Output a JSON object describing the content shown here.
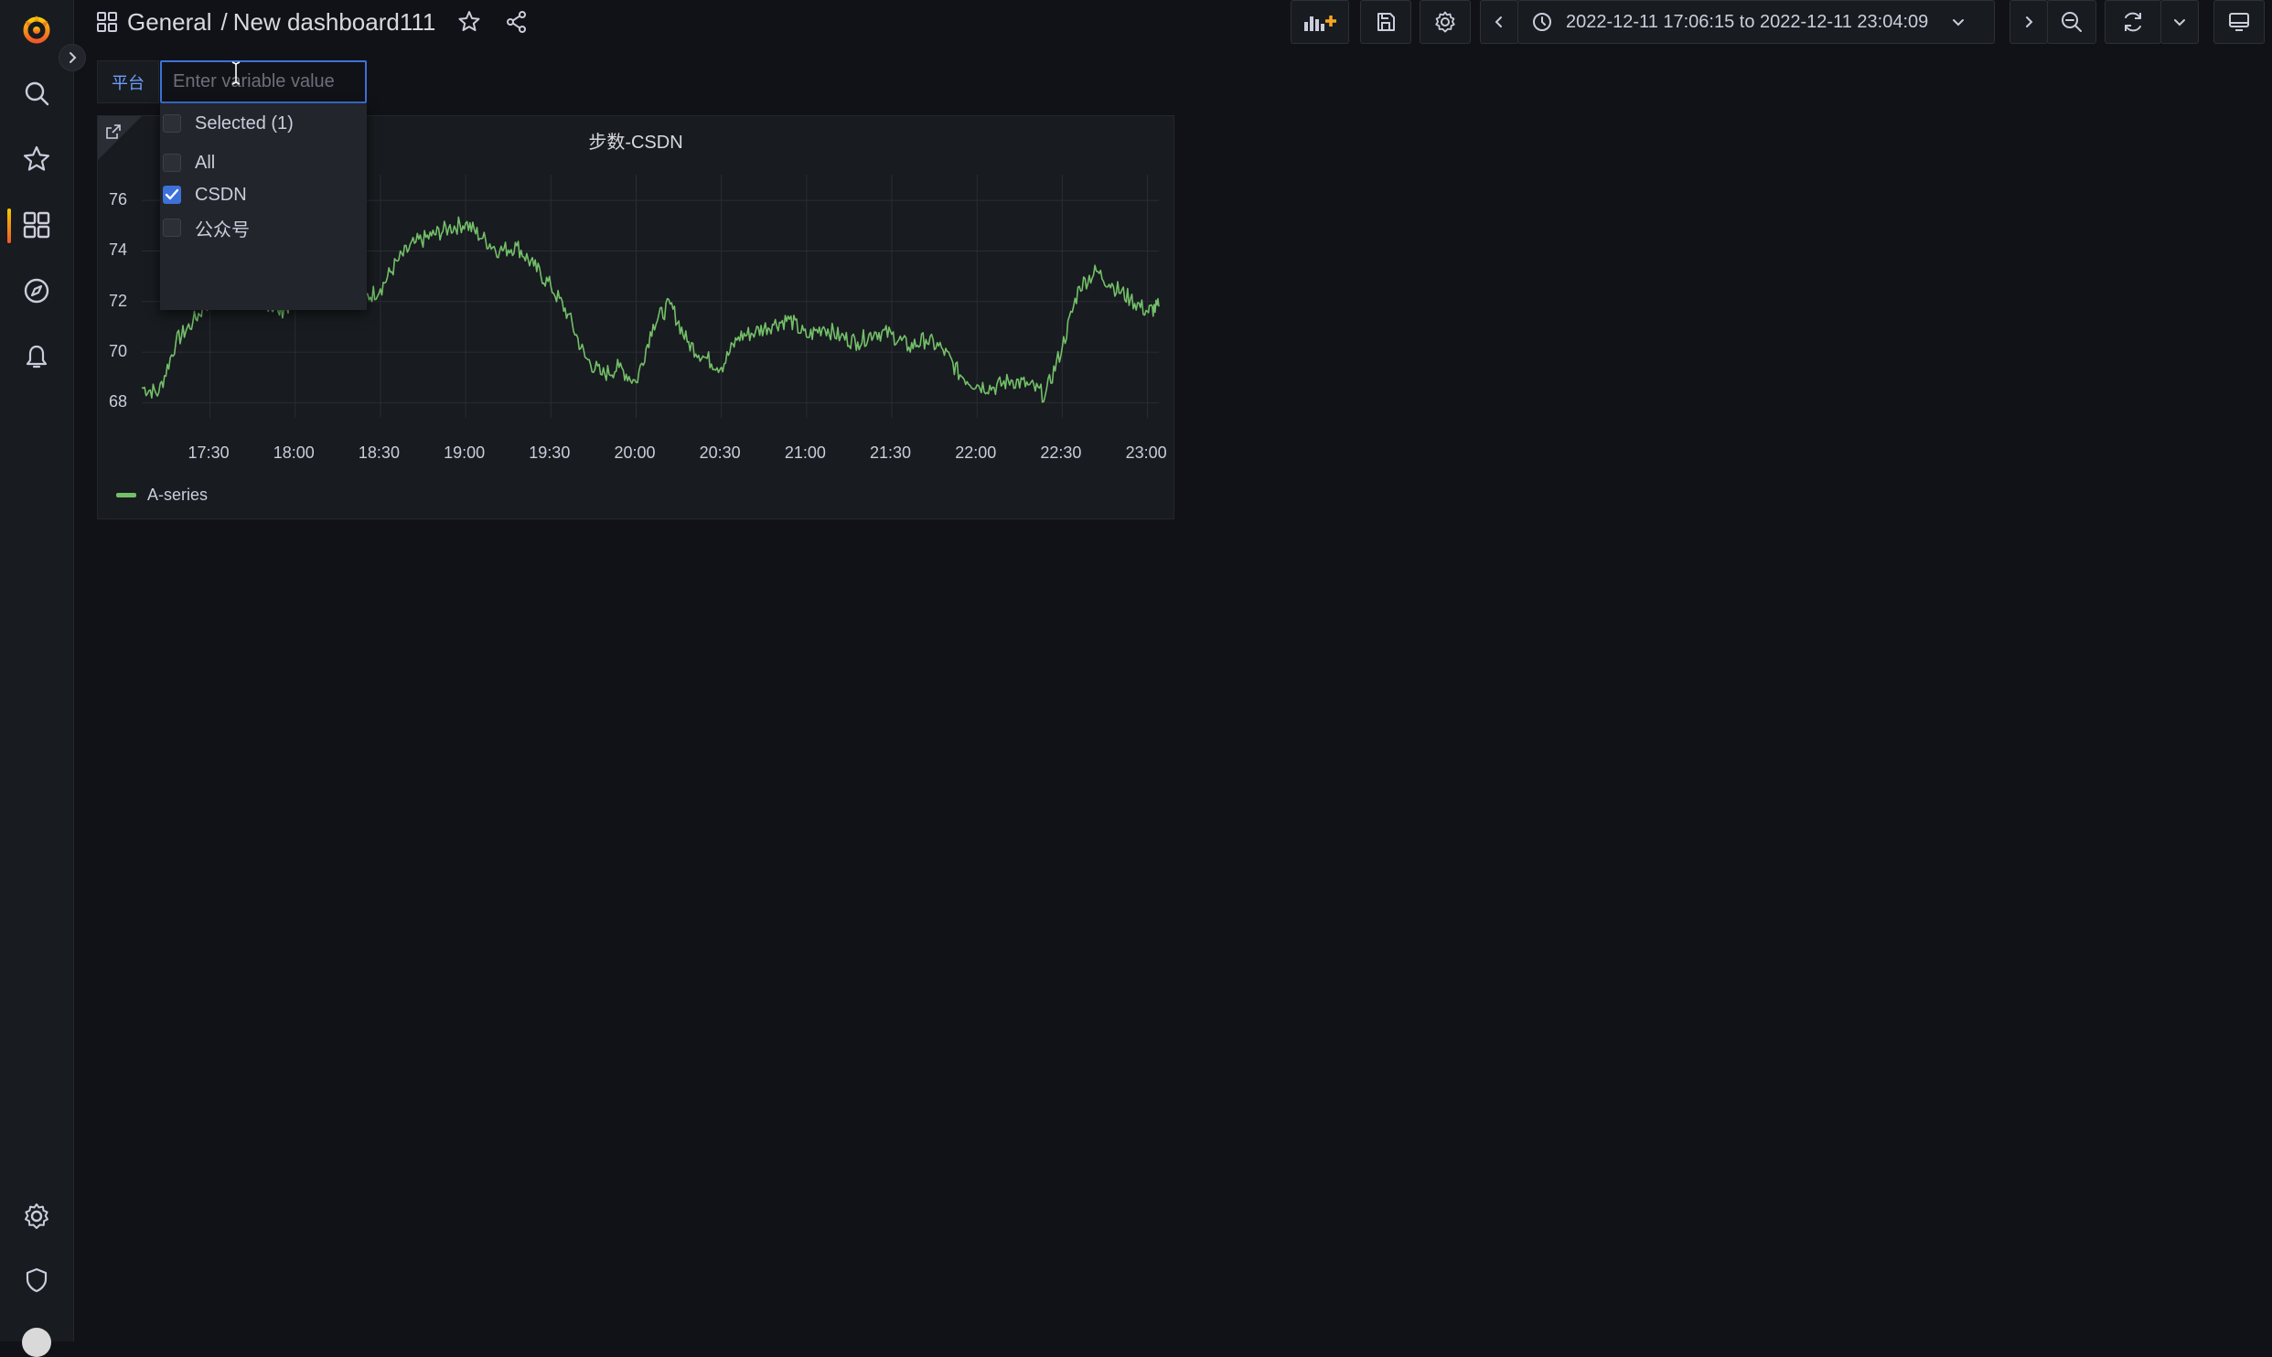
{
  "topbar": {
    "breadcrumb_folder": "General",
    "breadcrumb_separator": "/",
    "breadcrumb_dashboard": "New dashboard111",
    "time_range": "2022-12-11 17:06:15 to 2022-12-11 23:04:09"
  },
  "variable": {
    "label": "平台",
    "input_placeholder": "Enter variable value",
    "options": [
      {
        "label": "Selected (1)",
        "checked": false
      },
      {
        "label": "All",
        "checked": false
      },
      {
        "label": "CSDN",
        "checked": true
      },
      {
        "label": "公众号",
        "checked": false
      }
    ]
  },
  "panel": {
    "title": "步数-CSDN"
  },
  "chart_data": {
    "type": "line",
    "title": "步数-CSDN",
    "xlabel": "",
    "ylabel": "",
    "x_ticks": [
      "17:30",
      "18:00",
      "18:30",
      "19:00",
      "19:30",
      "20:00",
      "20:30",
      "21:00",
      "21:30",
      "22:00",
      "22:30",
      "23:00"
    ],
    "y_ticks": [
      68,
      70,
      72,
      74,
      76
    ],
    "x_range": [
      "17:06",
      "23:04"
    ],
    "ylim": [
      67.4,
      76.8
    ],
    "grid": true,
    "legend_position": "bottom-left",
    "series": [
      {
        "name": "A-series",
        "color": "#73bf69",
        "x": [
          "17:06",
          "17:12",
          "17:18",
          "17:24",
          "17:30",
          "17:36",
          "17:42",
          "17:48",
          "17:54",
          "18:00",
          "18:06",
          "18:12",
          "18:18",
          "18:24",
          "18:30",
          "18:36",
          "18:42",
          "18:48",
          "18:54",
          "19:00",
          "19:06",
          "19:12",
          "19:18",
          "19:24",
          "19:30",
          "19:36",
          "19:42",
          "19:48",
          "19:54",
          "20:00",
          "20:06",
          "20:12",
          "20:18",
          "20:24",
          "20:30",
          "20:36",
          "20:42",
          "20:48",
          "20:54",
          "21:00",
          "21:06",
          "21:12",
          "21:18",
          "21:24",
          "21:30",
          "21:36",
          "21:42",
          "21:48",
          "21:54",
          "22:00",
          "22:06",
          "22:12",
          "22:18",
          "22:24",
          "22:30",
          "22:36",
          "22:42",
          "22:48",
          "22:54",
          "23:00",
          "23:04"
        ],
        "values": [
          68.6,
          68.4,
          70.4,
          71.2,
          72.1,
          72.3,
          71.8,
          72.2,
          71.6,
          72.0,
          72.4,
          72.9,
          72.0,
          72.1,
          72.5,
          73.6,
          74.3,
          74.6,
          74.9,
          75.1,
          74.5,
          74.0,
          74.2,
          73.4,
          72.6,
          71.5,
          69.8,
          69.1,
          69.4,
          68.8,
          71.1,
          71.9,
          70.4,
          69.8,
          69.4,
          70.6,
          70.8,
          71.1,
          71.3,
          70.6,
          71.0,
          70.6,
          70.4,
          70.8,
          70.7,
          70.2,
          70.5,
          70.1,
          69.1,
          68.7,
          68.6,
          68.9,
          68.7,
          68.3,
          70.2,
          72.6,
          73.2,
          72.6,
          72.1,
          71.6,
          71.8
        ]
      }
    ]
  }
}
